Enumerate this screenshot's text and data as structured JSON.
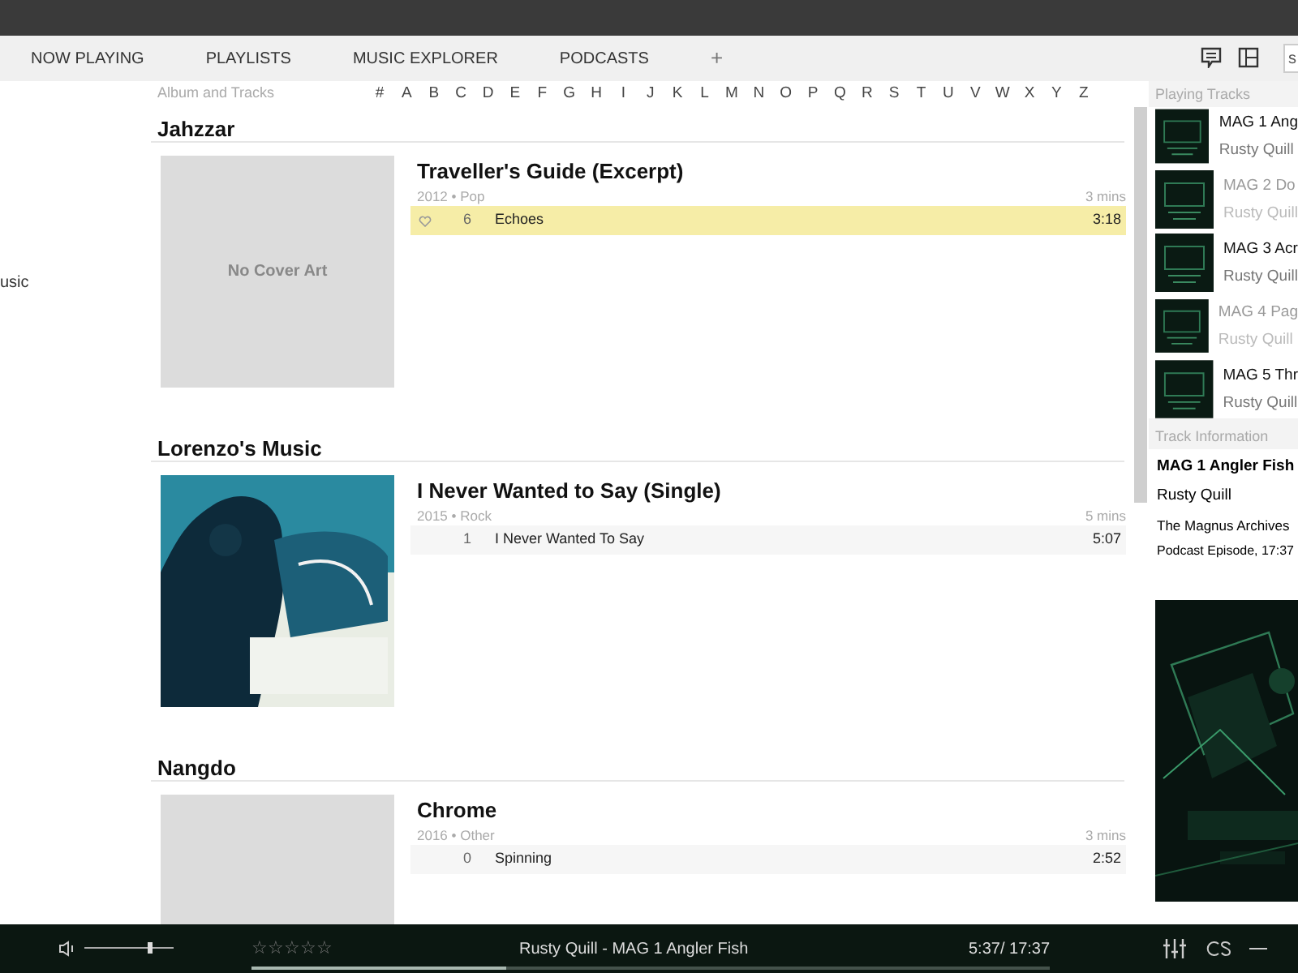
{
  "tabs": [
    {
      "label": "NOW PLAYING",
      "selected": false
    },
    {
      "label": "PLAYLISTS",
      "selected": false
    },
    {
      "label": "MUSIC EXPLORER",
      "selected": false
    },
    {
      "label": "PODCASTS",
      "selected": false
    },
    {
      "label": "+",
      "selected": false
    }
  ],
  "search": {
    "placeholder": "s"
  },
  "sidebar": {
    "items": [
      {
        "label": "usic"
      }
    ]
  },
  "browser": {
    "title": "Album and Tracks",
    "index": [
      "#",
      "A",
      "B",
      "C",
      "D",
      "E",
      "F",
      "G",
      "H",
      "I",
      "J",
      "K",
      "L",
      "M",
      "N",
      "O",
      "P",
      "Q",
      "R",
      "S",
      "T",
      "U",
      "V",
      "W",
      "X",
      "Y",
      "Z"
    ]
  },
  "artists": [
    {
      "name": "Jahzzar",
      "album": {
        "cover": {
          "kind": "none",
          "text": "No Cover Art"
        },
        "title": "Traveller's Guide (Excerpt)",
        "meta": "2012 • Pop",
        "length": "3 mins",
        "tracks": [
          {
            "number": "6",
            "title": "Echoes",
            "duration": "3:18",
            "selected": true
          }
        ]
      }
    },
    {
      "name": "Lorenzo's Music",
      "album": {
        "title": "I Never Wanted to Say (Single)",
        "meta": "2015 • Rock",
        "length": "5 mins",
        "tracks": [
          {
            "number": "1",
            "title": "I Never Wanted To Say",
            "duration": "5:07",
            "selected": false
          }
        ]
      }
    },
    {
      "name": "Nangdo",
      "album": {
        "cover": {
          "kind": "blank"
        },
        "title": "Chrome",
        "meta": "2016 • Other",
        "length": "3 mins",
        "tracks": [
          {
            "number": "0",
            "title": "Spinning",
            "duration": "2:52",
            "selected": false
          }
        ]
      }
    }
  ],
  "playing_tracks": {
    "title": "Playing Tracks",
    "items": [
      {
        "title": "MAG 1 Ang",
        "artist": "Rusty Quill",
        "dimmed": false
      },
      {
        "title": "MAG 2 Do",
        "artist": "Rusty Quill",
        "dimmed": true
      },
      {
        "title": "MAG 3 Acr",
        "artist": "Rusty Quill",
        "dimmed": false
      },
      {
        "title": "MAG 4 Pag",
        "artist": "Rusty Quill",
        "dimmed": true
      },
      {
        "title": "MAG 5 Thr",
        "artist": "Rusty Quill",
        "dimmed": false
      }
    ]
  },
  "track_information": {
    "title": "Track Information",
    "track": "MAG 1 Angler Fish",
    "artist": "Rusty Quill",
    "album": "The Magnus Archives",
    "details": "Podcast Episode, 17:37"
  },
  "player": {
    "volume": {
      "level": 0.73
    },
    "stars": 0,
    "now_playing": "Rusty Quill - MAG 1 Angler Fish",
    "progress": {
      "level": 0.32
    },
    "time": "5:37/ 17:37"
  }
}
